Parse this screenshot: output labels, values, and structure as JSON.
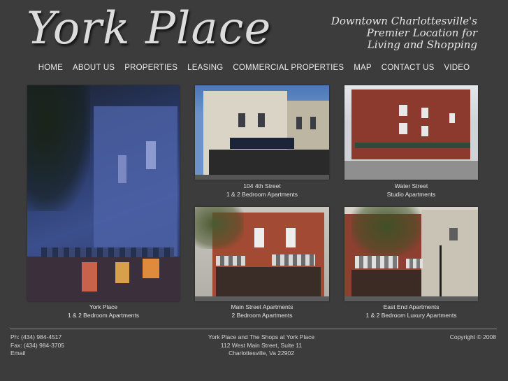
{
  "header": {
    "logo_text": "York Place",
    "tagline": [
      "Downtown Charlottesville's",
      "Premier Location for",
      "Living and Shopping"
    ]
  },
  "nav": [
    "HOME",
    "ABOUT US",
    "PROPERTIES",
    "LEASING",
    "COMMERCIAL PROPERTIES",
    "MAP",
    "CONTACT US",
    "VIDEO"
  ],
  "properties": [
    {
      "name": "York Place",
      "detail": "1 & 2 Bedroom Apartments"
    },
    {
      "name": "104 4th Street",
      "detail": "1 & 2 Bedroom Apartments"
    },
    {
      "name": "Water Street",
      "detail": "Studio Apartments"
    },
    {
      "name": "Main Street Apartments",
      "detail": "2 Bedroom Apartments"
    },
    {
      "name": "East End Apartments",
      "detail": "1 & 2 Bedroom Luxury Apartments"
    }
  ],
  "footer": {
    "contact": {
      "phone": "Ph: (434) 984-4517",
      "fax": "Fax: (434) 984-3705",
      "email": "Email"
    },
    "address": [
      "York Place and The Shops at York Place",
      "112 West Main Street, Suite 11",
      "Charlottesville, Va 22902"
    ],
    "copyright": "Copyright © 2008"
  }
}
